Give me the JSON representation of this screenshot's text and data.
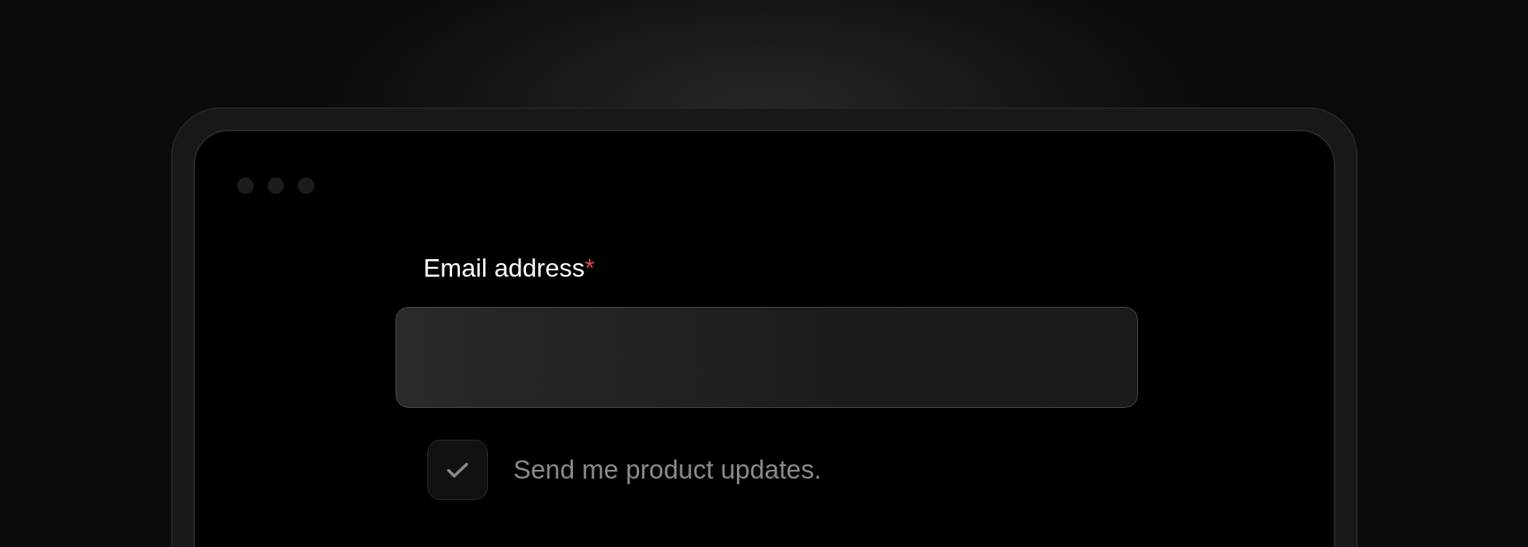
{
  "form": {
    "email": {
      "label": "Email address",
      "required_mark": "*"
    },
    "updates": {
      "label": "Send me product updates.",
      "checked": true
    }
  }
}
